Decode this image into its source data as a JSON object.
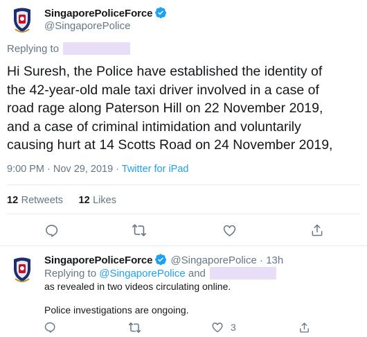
{
  "main_tweet": {
    "display_name": "SingaporePoliceForce",
    "handle": "@SingaporePolice",
    "replying_to_label": "Replying to",
    "text_lines": [
      "Hi Suresh, the Police have established the identity of",
      "the 42-year-old male taxi driver involved in a case of",
      "road rage along Paterson Hill on 22 November 2019,",
      "and a case of criminal intimidation and voluntarily",
      "causing hurt at 14 Scotts Road on 24 November 2019,"
    ],
    "timestamp": "9:00 PM · Nov 29, 2019 · ",
    "source": "Twitter for iPad",
    "retweets_count": "12",
    "retweets_label": "Retweets",
    "likes_count": "12",
    "likes_label": "Likes"
  },
  "reply_tweet": {
    "display_name": "SingaporePoliceForce",
    "handle_time": "@SingaporePolice · 13h",
    "replying_to_label": "Replying to",
    "replying_to_handle": "@SingaporePolice",
    "replying_and": " and",
    "line1": "as revealed in two videos circulating online.",
    "line2": "Police investigations are ongoing.",
    "likes_count": "3"
  },
  "colors": {
    "accent": "#1da1f2",
    "muted": "#657786",
    "text": "#14171a",
    "divider": "#e6ecf0",
    "redaction": "#e8def7"
  },
  "icons": [
    "police-crest-icon",
    "verified-badge-icon",
    "reply-icon",
    "retweet-icon",
    "like-icon",
    "share-icon"
  ]
}
